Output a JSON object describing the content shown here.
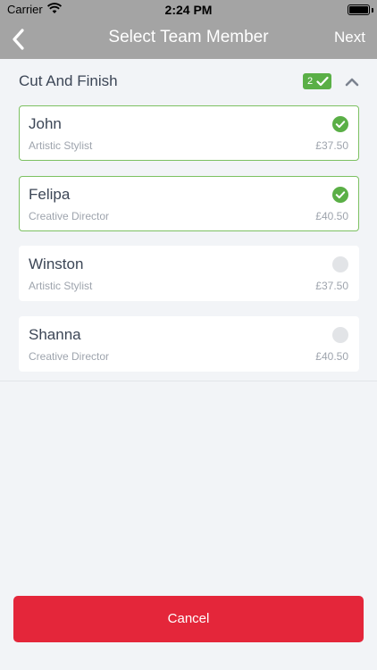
{
  "status_bar": {
    "carrier": "Carrier",
    "time": "2:24 PM"
  },
  "nav": {
    "title": "Select Team Member",
    "next_label": "Next",
    "back_icon": "chevron-left-icon"
  },
  "section": {
    "title": "Cut And Finish",
    "selected_count": "2"
  },
  "members": [
    {
      "name": "John",
      "role": "Artistic Stylist",
      "price": "£37.50",
      "selected": true
    },
    {
      "name": "Felipa",
      "role": "Creative Director",
      "price": "£40.50",
      "selected": true
    },
    {
      "name": "Winston",
      "role": "Artistic Stylist",
      "price": "£37.50",
      "selected": false
    },
    {
      "name": "Shanna",
      "role": "Creative Director",
      "price": "£40.50",
      "selected": false
    }
  ],
  "footer": {
    "cancel_label": "Cancel"
  },
  "colors": {
    "accent_green": "#5aaf46",
    "selected_border": "#7dc162",
    "cancel_red": "#e4263a",
    "nav_bar": "#a4a4a4"
  }
}
